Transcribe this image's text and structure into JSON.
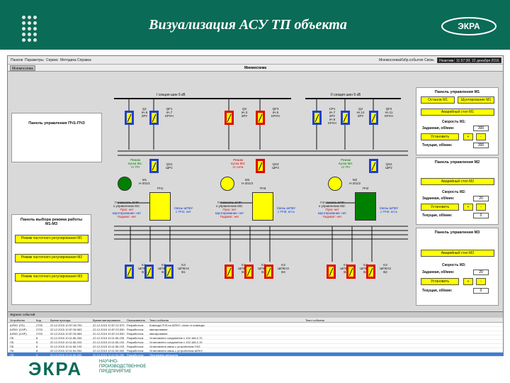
{
  "banner": {
    "title": "Визуализация АСУ ТП объекта",
    "logo_text": "ЭКРА"
  },
  "menu": {
    "items": [
      "Панели",
      "Параметры",
      "Сервис",
      "Методика",
      "Справка"
    ],
    "right_items": [
      "Мнемосхема",
      "Избр.события",
      "Связь"
    ],
    "status_boxes": [
      "Неактивно",
      "11:57:39",
      "22 декабря 2016"
    ]
  },
  "main": {
    "tab": "Мнемосхема",
    "title": "Мнемосхема"
  },
  "bus": {
    "section1": "I секция шин 6 кВ",
    "section2": "II секция шин 6 кВ"
  },
  "cells_top": [
    {
      "id": "Q1",
      "lines": [
        "Q1",
        "яч.6",
        "ЗРУ"
      ]
    },
    {
      "id": "QF1",
      "lines": [
        "QF1",
        "яч.7",
        "КРУН"
      ]
    },
    {
      "id": "Q3",
      "lines": [
        "Q3",
        "яч.3",
        "ЗРУ"
      ]
    },
    {
      "id": "QF3",
      "lines": [
        "QF3",
        "яч.5",
        "КРУН"
      ]
    },
    {
      "id": "CP1",
      "lines": [
        "СР1",
        "яч.7",
        "ЗРУ",
        "яч.8",
        "КРУН"
      ]
    },
    {
      "id": "Q2",
      "lines": [
        "Q2",
        "яч.12",
        "ЗРУ"
      ]
    },
    {
      "id": "QF2",
      "lines": [
        "QF2",
        "яч.11",
        "КРУН"
      ]
    }
  ],
  "cells_mid": [
    {
      "id": "QS1",
      "lines": [
        "QS1",
        "ШР1"
      ]
    },
    {
      "id": "QS3",
      "lines": [
        "QS3",
        "ШР3"
      ]
    },
    {
      "id": "QS2",
      "lines": [
        "QS2",
        "ШР2"
      ]
    }
  ],
  "motors": [
    {
      "id": "M1",
      "lines": [
        "M1",
        "Н-201/1"
      ],
      "color": "#008000",
      "mode": [
        "Режим",
        "пуска М1:",
        "от ПЧ"
      ]
    },
    {
      "id": "M3",
      "lines": [
        "M3",
        "Н-201/3"
      ],
      "color": "#ffff00",
      "mode": [
        "Режим",
        "пуска М3:",
        "от сети"
      ]
    },
    {
      "id": "M2",
      "lines": [
        "M2",
        "Н-201/2"
      ],
      "color": "#ffff00",
      "mode": [
        "Режим",
        "пуска М2:",
        "от ПЧ"
      ]
    }
  ],
  "pch": [
    {
      "label": "ПЧ1",
      "color": "#ffff00",
      "status": [
        "Готовность СЧР",
        "к управлению М1:",
        "Пуск: нет",
        "Шунтирование: нет",
        "Подхват: нет"
      ],
      "link": [
        "Связь ШПКУ",
        "с ПЧ1: нет"
      ]
    },
    {
      "label": "ПЧ3",
      "color": "#ffff00",
      "status": [
        "Готовность СЧР",
        "к управлению М3:",
        "Пуск: нет",
        "Шунтирование: нет",
        "Подхват: нет"
      ],
      "link": [
        "Связь ШПКУ",
        "с ПЧ3: есть"
      ]
    },
    {
      "label": "ПЧ2",
      "color": "#008000",
      "status": [
        "Готовность СЧР",
        "к управлению М2:",
        "Пуск: нет",
        "Шунтирование: нет",
        "Подхват: нет"
      ],
      "link": [
        "Связь ШПКУ",
        "с ПЧ2: есть"
      ]
    }
  ],
  "shpk": [
    [
      "K1",
      "ШПКА1",
      "В1"
    ],
    [
      "K2",
      "ШПКА2",
      "В1"
    ],
    [
      "K3",
      "ШПКА3",
      "В1"
    ],
    [
      "K1",
      "ШПКА1",
      "В3"
    ],
    [
      "K2",
      "ШПКА2",
      "В3"
    ],
    [
      "K3",
      "ШПКА3",
      "В3"
    ],
    [
      "K1",
      "ШПКА1",
      "В2"
    ],
    [
      "K2",
      "ШПКА2",
      "В2"
    ],
    [
      "K3",
      "ШПКА3",
      "В2"
    ]
  ],
  "left_panel_top": {
    "title": "Панель управления ПЧ1-ПЧ3"
  },
  "left_panel_mode": {
    "title": "Панель выбора режима работы М1-М3",
    "buttons": [
      "Режим частотного регулирования М1",
      "Режим частотного регулирования М2",
      "Режим частотного регулирования М3"
    ]
  },
  "control_panels": [
    {
      "title": "Панель управления М1",
      "btn_stop": "Останов М1",
      "btn_shunt": "Шунтирование М1",
      "btn_emergency": "Аварийный стоп М1",
      "speed_label": "Скорость М1:",
      "setpoint_label": "Заданная, об/мин:",
      "setpoint": "300",
      "set_btn": "Установить",
      "current_label": "Текущая, об/мин:",
      "current": "300"
    },
    {
      "title": "Панель управления М2",
      "btn_emergency": "Аварийный стоп М2",
      "speed_label": "Скорость М2:",
      "setpoint_label": "Заданная, об/мин:",
      "setpoint": "20",
      "set_btn": "Установить",
      "current_label": "Текущая, об/мин:",
      "current": "0"
    },
    {
      "title": "Панель управления М3",
      "btn_emergency": "Аварийный стоп М3",
      "speed_label": "Скорость М3:",
      "setpoint_label": "Заданная, об/мин:",
      "setpoint": "20",
      "set_btn": "Установить",
      "current_label": "Текущая, об/мин:",
      "current": "0"
    }
  ],
  "events": {
    "header": "Журнал событий",
    "columns": [
      "Устройство",
      "Код",
      "Время прихода",
      "Время квитирования",
      "Пользователь",
      "Текст события",
      "Текст события"
    ],
    "rows": [
      [
        "ШПКУ (ПЧ)",
        "2705",
        "22.12.2015 10:57:38.754",
        "22.12.2015 10:57:22.570",
        "Разработчик",
        "Команда ПЧ3 на ШПКУ: отказ от команды"
      ],
      [
        "ШПКУ (СНР)",
        "2703",
        "22.12.2015 10:57:36.963",
        "22.12.2015 10:57:23.530",
        "Разработчик",
        "квитирование"
      ],
      [
        "ШПКУ (СНР)",
        "2703",
        "22.12.2015 10:57:35.965",
        "22.12.2015 10:57:23.530",
        "Разработчик",
        "квитирование"
      ],
      [
        "ПК",
        "8",
        "22.12.2015 10:11:56.263",
        "22.12.2015 10:11:56.235",
        "Разработчик",
        "Установлено соединение с 192.168.2.70"
      ],
      [
        "ПК",
        "8",
        "22.12.2015 10:11:56.203",
        "22.12.2015 10:11:56.193",
        "Разработчик",
        "Установлено соединение с 192.168.2.19"
      ],
      [
        "ПК",
        "8",
        "22.12.2015 10:11:56.193",
        "22.12.2015 10:11:56.193",
        "Разработчик",
        "Установлена связь с устройством ПЧ3"
      ],
      [
        "ПК",
        "8",
        "22.12.2015 10:11:54.554",
        "22.12.2015 10:11:54.553",
        "Разработчик",
        "Установлена связь с устройством ШПКУ"
      ],
      [
        "ПК",
        "0",
        "22.12.2015 10:11:54.050",
        "22.12.2015 10:11:54.050",
        "Разработчик",
        "Программа запущена"
      ]
    ]
  },
  "footer": {
    "logo_text": "ЭКРА",
    "tagline": [
      "НАУЧНО-",
      "ПРОИЗВОДСТВЕННОЕ",
      "ПРЕДПРИЯТИЕ"
    ]
  },
  "colors": {
    "banner": "#0a6b57",
    "yellow": "#ffff00",
    "green": "#008000",
    "blue_cell": "#1f3fcf",
    "red_cell": "#e00000"
  }
}
